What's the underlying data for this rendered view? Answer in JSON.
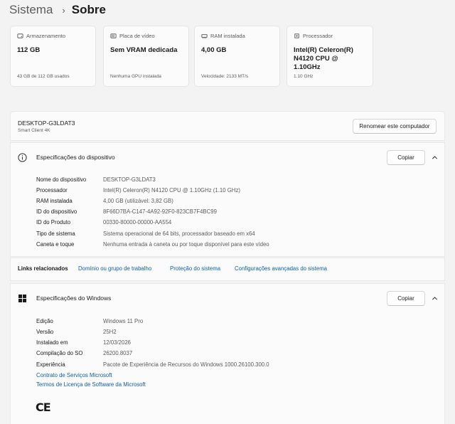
{
  "breadcrumb": {
    "parent": "Sistema",
    "separator": "›",
    "current": "Sobre"
  },
  "cards": [
    {
      "icon": "storage-icon",
      "label": "Armazenamento",
      "value": "112 GB",
      "sub": "43 GB de 112 GB usados"
    },
    {
      "icon": "video-card-icon",
      "label": "Placa de vídeo",
      "value": "Sem VRAM dedicada",
      "sub": "Nenhuma GPU instalada"
    },
    {
      "icon": "ram-icon",
      "label": "RAM instalada",
      "value": "4,00 GB",
      "sub": "Velocidade: 2133 MT/s"
    },
    {
      "icon": "processor-icon",
      "label": "Processador",
      "value": "Intel(R) Celeron(R) N4120 CPU @ 1.10GHz",
      "sub": "1.10 GHz"
    }
  ],
  "device": {
    "name": "DESKTOP-G3LDAT3",
    "model": "Smart Client 4K",
    "rename_label": "Renomear este computador"
  },
  "device_specs": {
    "title": "Especificações do dispositivo",
    "copy_label": "Copiar",
    "rows": [
      {
        "label": "Nome do dispositivo",
        "value": "DESKTOP-G3LDAT3"
      },
      {
        "label": "Processador",
        "value": "Intel(R) Celeron(R) N4120 CPU @ 1.10GHz (1.10 GHz)"
      },
      {
        "label": "RAM instalada",
        "value": "4,00 GB (utilizável: 3,82 GB)"
      },
      {
        "label": "ID do dispositivo",
        "value": "8F66D7BA-C147-4A92-92F0-823CB7F4BC99"
      },
      {
        "label": "ID do Produto",
        "value": "00330-80000-00000-AA554"
      },
      {
        "label": "Tipo de sistema",
        "value": "Sistema operacional de 64 bits, processador baseado em x64"
      },
      {
        "label": "Caneta e toque",
        "value": "Nenhuma entrada à caneta ou por toque disponível para este vídeo"
      }
    ]
  },
  "related_links": {
    "title": "Links relacionados",
    "items": [
      "Domínio ou grupo de trabalho",
      "Proteção do sistema",
      "Configurações avançadas do sistema"
    ]
  },
  "windows_specs": {
    "title": "Especificações do Windows",
    "copy_label": "Copiar",
    "rows": [
      {
        "label": "Edição",
        "value": "Windows 11 Pro"
      },
      {
        "label": "Versão",
        "value": "25H2"
      },
      {
        "label": "Instalado em",
        "value": "12/03/2026"
      },
      {
        "label": "Compilação do SO",
        "value": "26200.8037"
      },
      {
        "label": "Experiência",
        "value": "Pacote de Experiência de Recursos do Windows 1000.26100.300.0"
      }
    ],
    "links": [
      "Contrato de Serviços Microsoft",
      "Termos de Licença de Software da Microsoft"
    ],
    "ce_mark": "CE"
  }
}
